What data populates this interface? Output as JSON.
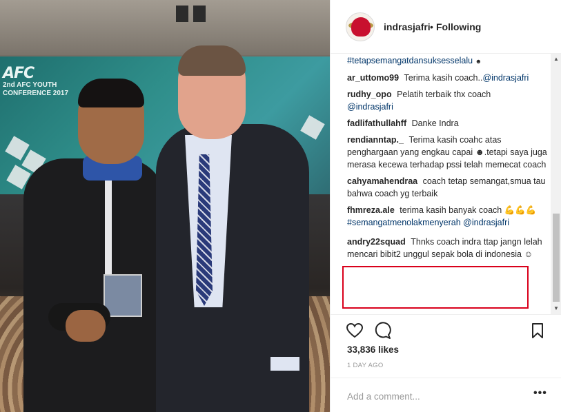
{
  "post": {
    "username": "indrasjafri",
    "separator": "•",
    "follow_state": "Following",
    "likes": "33,836 likes",
    "time_ago": "1 DAY AGO",
    "comment_placeholder": "Add a comment...",
    "more_label": "•••"
  },
  "photo": {
    "banner_logo": "AFC",
    "banner_sub": "2nd AFC YOUTH\nCONFERENCE 2017"
  },
  "comments": [
    {
      "user": "",
      "text": "",
      "tag": "#tetapsemangatdansuksesselalu",
      "emoji": "☻"
    },
    {
      "user": "ar_uttomo99",
      "text": "Terima kasih coach..",
      "tag": "@indrasjafri"
    },
    {
      "user": "rudhy_opo",
      "text": "Pelatih terbaik thx coach",
      "tag": "@indrasjafri"
    },
    {
      "user": "fadlifathullahff",
      "text": "Danke Indra",
      "tag": ""
    },
    {
      "user": "rendianntap._",
      "text": "Terima kasih coahc atas penghargaan yang engkau capai ☻.tetapi saya juga merasa kecewa terhadap pssi telah memecat coach",
      "tag": ""
    },
    {
      "user": "cahyamahendraa",
      "text": "coach tetap semangat,smua tau bahwa coach yg terbaik",
      "tag": ""
    },
    {
      "user": "fhmreza.ale",
      "text": "terima kasih banyak coach 💪💪💪",
      "tag": "#semangatmenolakmenyerah @indrasjafri"
    },
    {
      "user": "andry22squad",
      "text": "Thnks coach indra ttap jangn lelah mencari bibit2 unggul sepak bola di indonesia ☺",
      "tag": ""
    }
  ],
  "icons": {
    "heart": "heart-icon",
    "comment": "comment-icon",
    "bookmark": "bookmark-icon"
  },
  "colors": {
    "highlight": "#d9001b",
    "link": "#003569"
  }
}
